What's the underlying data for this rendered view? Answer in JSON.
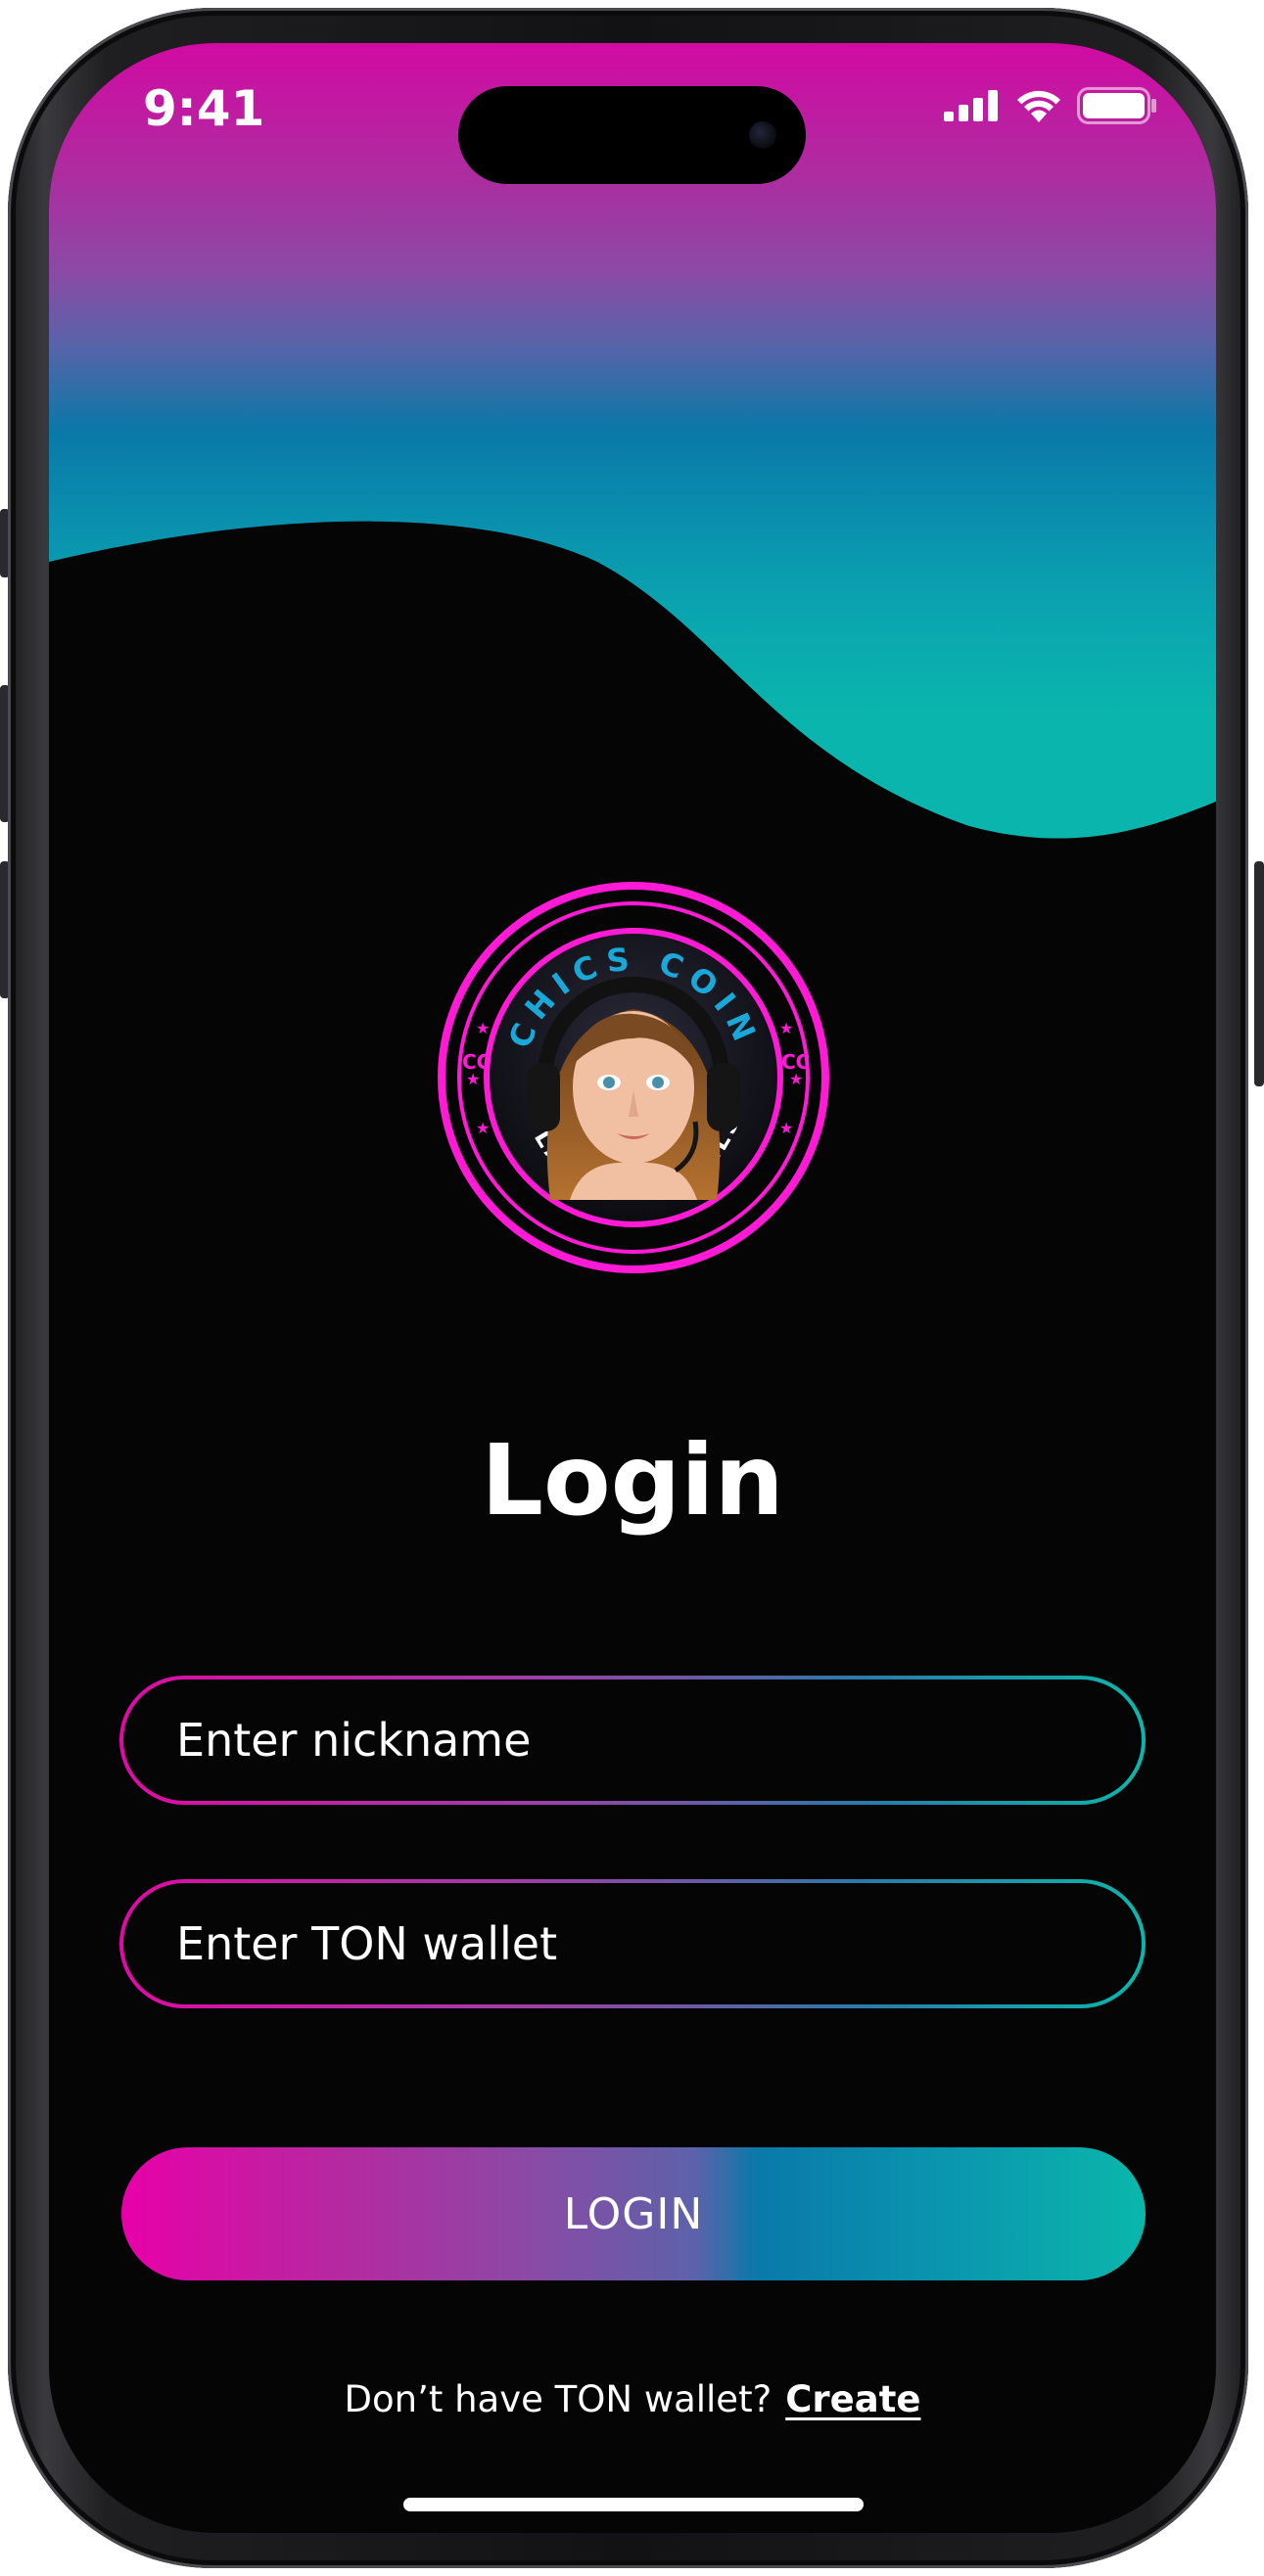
{
  "status_bar": {
    "time": "9:41",
    "signal_icon": "cellular-signal-icon",
    "wifi_icon": "wifi-icon",
    "battery_icon": "battery-icon"
  },
  "logo": {
    "top_text": "CHICS COIN",
    "bottom_text": "PLAY WITH GIRLS",
    "monogram": "CC",
    "ring_color": "#ff1ad6",
    "text_color": "#1aa8d8"
  },
  "login": {
    "title": "Login",
    "nickname_placeholder": "Enter nickname",
    "wallet_placeholder": "Enter TON wallet",
    "button_label": "LOGIN",
    "footer_question": "Don’t have TON wallet?",
    "footer_link": "Create"
  },
  "colors": {
    "pink": "#e800a8",
    "purple": "#8a4aa6",
    "blue": "#0a79aa",
    "teal": "#0ab7ab",
    "background": "#050505"
  }
}
